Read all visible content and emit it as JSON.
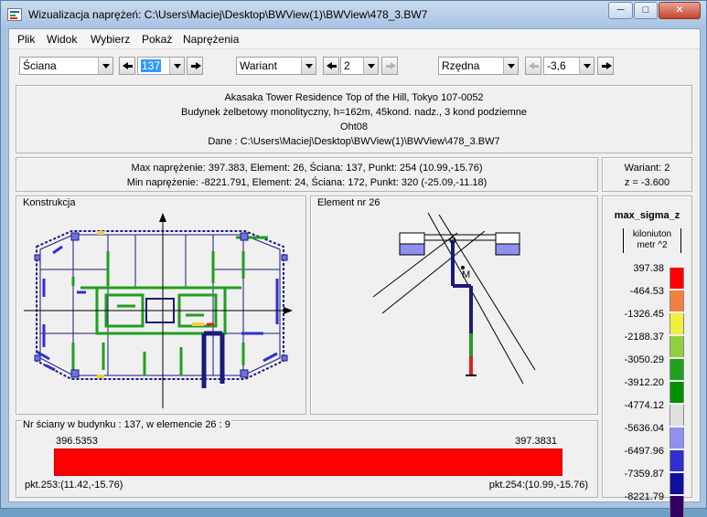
{
  "window": {
    "title": "Wizualizacja naprężeń: C:\\Users\\Maciej\\Desktop\\BWView(1)\\BWView\\478_3.BW7"
  },
  "menu": {
    "items": [
      "Plik",
      "Widok",
      "Wybierz",
      "Pokaż",
      "Naprężenia"
    ]
  },
  "toolbar": {
    "wall_type": "Ściana",
    "wall_number": "137",
    "variant_label": "Wariant",
    "variant_value": "2",
    "ordinate_label": "Rzędna",
    "ordinate_value": "-3,6"
  },
  "project": {
    "line1": "Akasaka Tower Residence Top of the Hill, Tokyo 107-0052",
    "line2": "Budynek żelbetowy monolityczny, h=162m, 45kond. nadz., 3 kond podziemne",
    "line3": "Oht08",
    "line4": "Dane :  C:\\Users\\Maciej\\Desktop\\BWView(1)\\BWView\\478_3.BW7"
  },
  "stress": {
    "max_line": "Max naprężenie: 397.383,   Element: 26,   Ściana: 137,   Punkt: 254 (10.99,-15.76)",
    "min_line": "Min naprężenie: -8221.791,   Element: 24,   Ściana: 172,   Punkt: 320 (-25.09,-11.18)"
  },
  "variant_info": {
    "variant": "Wariant: 2",
    "z": "z = -3.600"
  },
  "panels": {
    "construction_label": "Konstrukcja",
    "element_label": "Element nr 26",
    "element_marker": "M"
  },
  "wall_info": {
    "label": "Nr ściany w budynku :  137,    w elemencie 26 :  9",
    "left_value": "396.5353",
    "right_value": "397.3831",
    "left_point": "pkt.253:(11.42,-15.76)",
    "right_point": "pkt.254:(10.99,-15.76)",
    "bar_color": "#ff0000"
  },
  "legend": {
    "title": "max_sigma_z",
    "unit_top": "kiloniuton",
    "unit_bottom": "metr ^2",
    "values": [
      "397.38",
      "-464.53",
      "-1326.45",
      "-2188.37",
      "-3050.29",
      "-3912.20",
      "-4774.12",
      "-5636.04",
      "-6497.96",
      "-7359.87",
      "-8221.79"
    ],
    "colors": [
      "#ff0000",
      "#f08040",
      "#f0f040",
      "#90d040",
      "#20a020",
      "#009000",
      "#e0e0e0",
      "#9090f0",
      "#3030d0",
      "#1010a0",
      "#300060"
    ]
  }
}
